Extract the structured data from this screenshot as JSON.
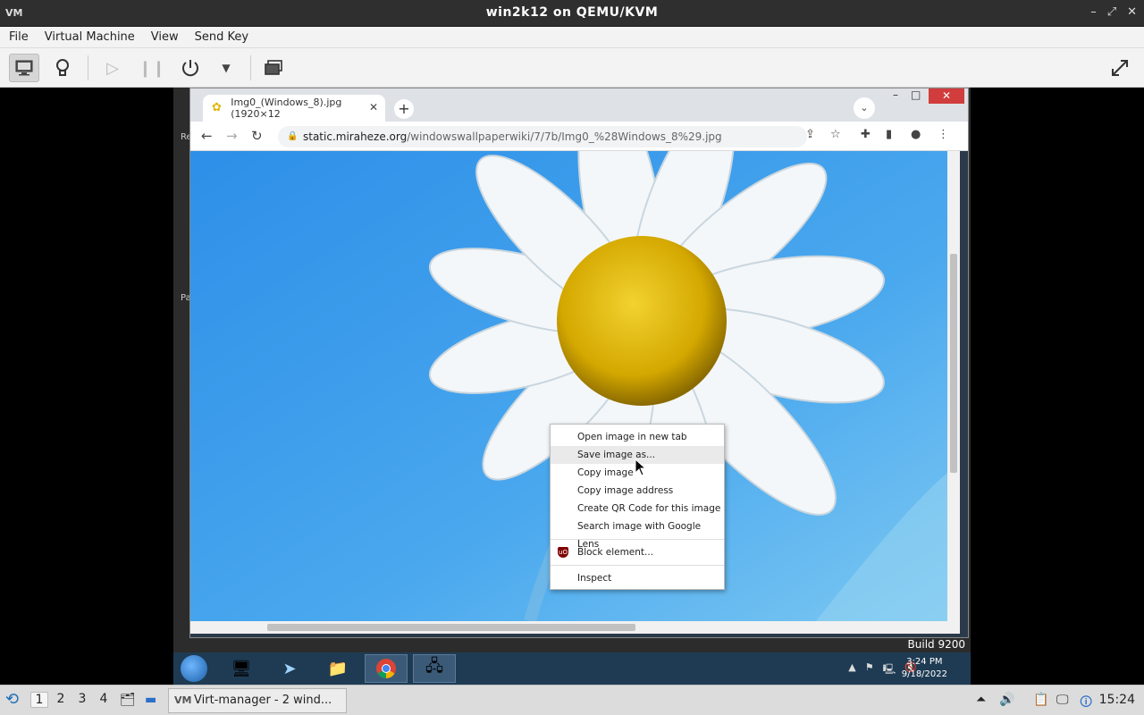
{
  "host_window": {
    "title": "win2k12 on QEMU/KVM",
    "logo": "VM",
    "controls": [
      "–",
      "⤢",
      "✕"
    ]
  },
  "menu": {
    "items": [
      "File",
      "Virtual Machine",
      "View",
      "Send Key"
    ]
  },
  "toolbar": {
    "icons": [
      "console-icon",
      "details-icon",
      "run-icon",
      "pause-icon",
      "power-icon",
      "power-menu-chevron-icon",
      "snapshots-icon",
      "fullscreen-icon"
    ]
  },
  "guest": {
    "desktop_icons": [
      "Re",
      "Pa"
    ],
    "build_label": "Build 9200",
    "browser": {
      "tab_title": "Img0_(Windows_8).jpg (1920×12",
      "tab_close": "✕",
      "new_tab": "+",
      "url_host": "static.miraheze.org",
      "url_path": "/windowswallpaperwiki/7/7b/Img0_%28Windows_8%29.jpg",
      "window_controls": [
        "–",
        "□",
        "✕"
      ]
    },
    "context_menu": {
      "items": [
        "Open image in new tab",
        "Save image as...",
        "Copy image",
        "Copy image address",
        "Create QR Code for this image",
        "Search image with Google Lens"
      ],
      "extension_item": "Block element...",
      "extension_icon_text": "uO",
      "inspect_item": "Inspect",
      "hovered_index": 1
    },
    "taskbar": {
      "clock_time": "3:24 PM",
      "clock_date": "9/18/2022"
    }
  },
  "host_taskbar": {
    "workspaces": [
      "1",
      "2",
      "3",
      "4"
    ],
    "active_workspace": "1",
    "task_label": "Virt-manager - 2 wind...",
    "clock": "15:24"
  }
}
